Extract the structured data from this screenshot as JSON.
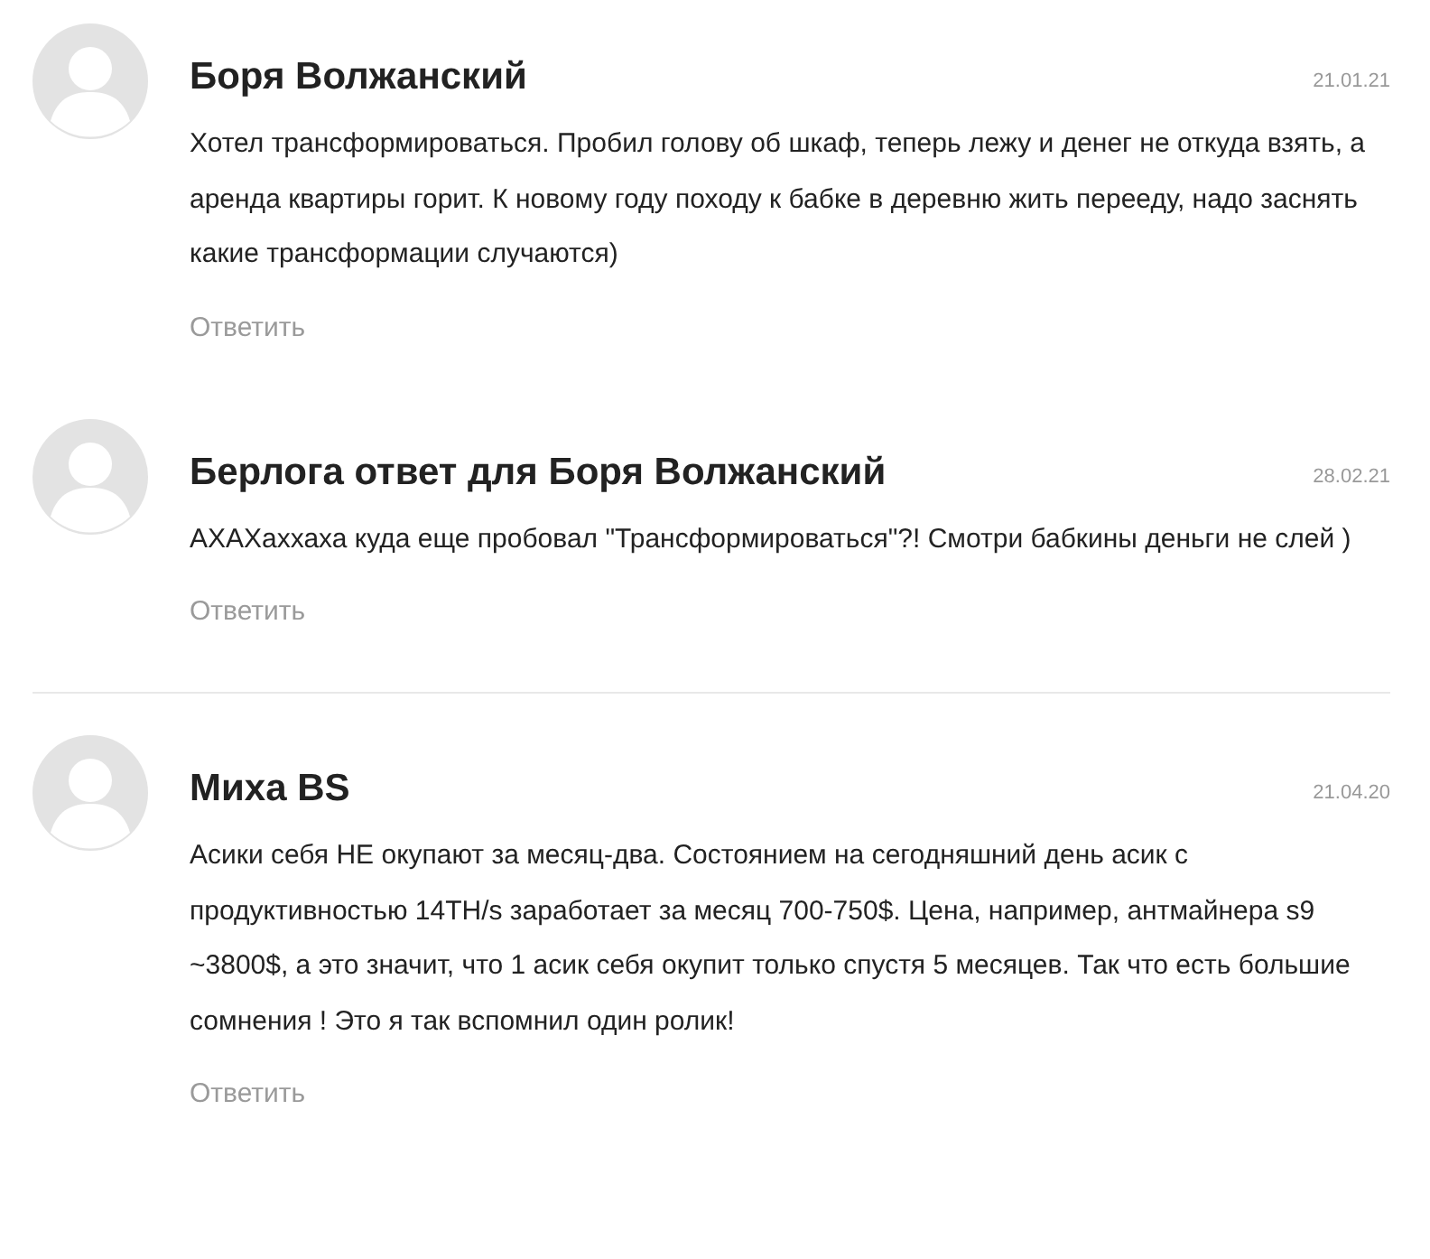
{
  "threads": [
    {
      "comments": [
        {
          "author": "Боря Волжанский",
          "date": "21.01.21",
          "text": "Хотел трансформироваться. Пробил голову об шкаф, теперь лежу и денег не откуда взять, а аренда квартиры горит. К новому году походу к бабке в деревню жить перееду, надо заснять какие трансформации случаются)",
          "reply": "Ответить"
        },
        {
          "author": "Берлога ответ для Боря Волжанский",
          "date": "28.02.21",
          "text": "АХАХаххаха куда еще пробовал \"Трансформироваться\"?! Смотри бабкины деньги не слей )",
          "reply": "Ответить"
        }
      ]
    },
    {
      "comments": [
        {
          "author": "Миха BS",
          "date": "21.04.20",
          "text": "Асики себя НЕ окупают за месяц-два. Состоянием на сегодняшний день асик с продуктивностью 14TH/s заработает за месяц 700-750$. Цена, например, антмайнера s9 ~3800$, а это значит, что 1 асик себя окупит только спустя 5 месяцев. Так что есть большие сомнения ! Это я так вспомнил один ролик!",
          "reply": "Ответить"
        }
      ]
    }
  ]
}
